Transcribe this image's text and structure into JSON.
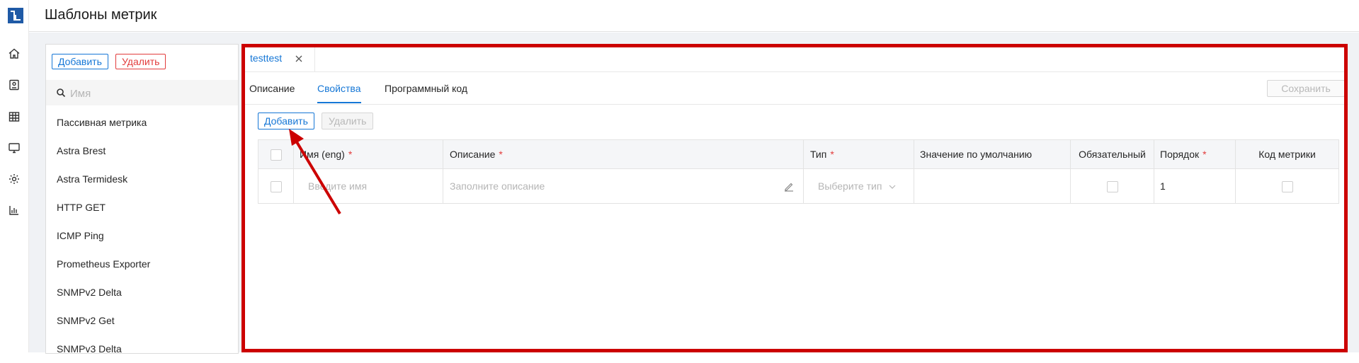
{
  "header": {
    "title": "Шаблоны метрик"
  },
  "rail": {
    "icons": [
      "home-icon",
      "id-card-icon",
      "table-icon",
      "monitor-icon",
      "gear-icon",
      "bar-chart-icon"
    ]
  },
  "list_panel": {
    "add_label": "Добавить",
    "delete_label": "Удалить",
    "search_placeholder": "Имя",
    "items": [
      "Пассивная метрика",
      "Astra Brest",
      "Astra Termidesk",
      "HTTP GET",
      "ICMP Ping",
      "Prometheus Exporter",
      "SNMPv2 Delta",
      "SNMPv2 Get",
      "SNMPv3 Delta"
    ]
  },
  "editor": {
    "open_tab": "testtest",
    "tabs": [
      "Описание",
      "Свойства",
      "Программный код"
    ],
    "active_tab": "Свойства",
    "save_label": "Сохранить",
    "add_label": "Добавить",
    "delete_label": "Удалить",
    "table": {
      "columns": {
        "name": "Имя (eng)",
        "description": "Описание",
        "type": "Тип",
        "default": "Значение по умолчанию",
        "required": "Обязательный",
        "order": "Порядок",
        "metric_code": "Код метрики"
      },
      "row": {
        "name_placeholder": "Введите имя",
        "description_placeholder": "Заполните описание",
        "type_placeholder": "Выберите тип",
        "default": "",
        "order": "1"
      }
    }
  },
  "colors": {
    "accent": "#1677d6",
    "danger": "#e23c3c",
    "highlight": "#cc0000"
  }
}
